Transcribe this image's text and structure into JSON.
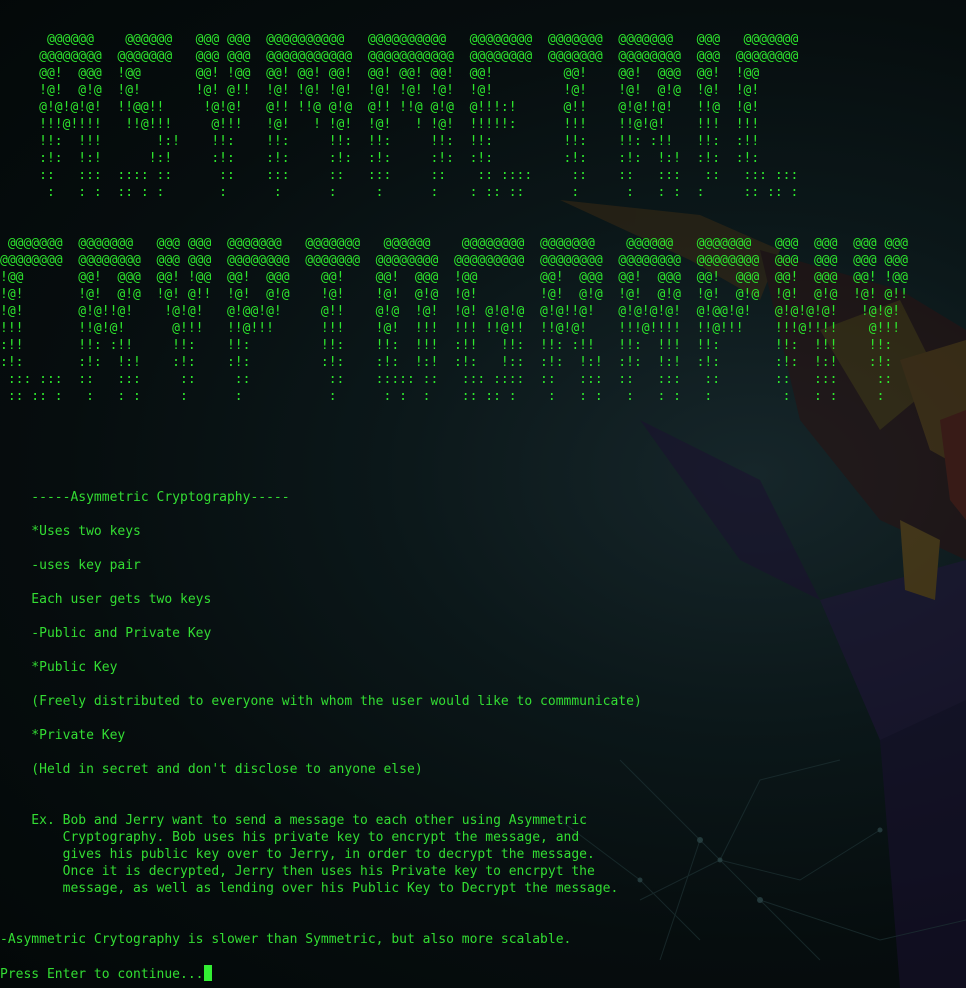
{
  "banner_top": [
    "      @@@@@@    @@@@@@   @@@ @@@  @@@@@@@@@@   @@@@@@@@@@   @@@@@@@@  @@@@@@@  @@@@@@@   @@@   @@@@@@@",
    "     @@@@@@@@  @@@@@@@   @@@ @@@  @@@@@@@@@@@  @@@@@@@@@@@  @@@@@@@@  @@@@@@@  @@@@@@@@  @@@  @@@@@@@@",
    "     @@!  @@@  !@@       @@! !@@  @@! @@! @@!  @@! @@! @@!  @@!         @@!    @@!  @@@  @@!  !@@",
    "     !@!  @!@  !@!       !@! @!!  !@! !@! !@!  !@! !@! !@!  !@!         !@!    !@!  @!@  !@!  !@!",
    "     @!@!@!@!  !!@@!!     !@!@!   @!! !!@ @!@  @!! !!@ @!@  @!!!:!      @!!    @!@!!@!   !!@  !@!",
    "     !!!@!!!!   !!@!!!     @!!!   !@!   ! !@!  !@!   ! !@!  !!!!!:      !!!    !!@!@!    !!!  !!!",
    "     !!:  !!!       !:!    !!:    !!:     !!:  !!:     !!:  !!:         !!:    !!: :!!   !!:  :!!",
    "     :!:  !:!      !:!     :!:    :!:     :!:  :!:     :!:  :!:         :!:    :!:  !:!  :!:  :!:",
    "     ::   :::  :::: ::      ::    :::     ::   :::     ::    :: ::::     ::    ::   :::   ::   ::: :::",
    "      :   : :  :: : :       :      :      :     :      :    : :: ::      :      :   : :  :     :: :: :"
  ],
  "banner_bottom": [
    " @@@@@@@  @@@@@@@   @@@ @@@  @@@@@@@   @@@@@@@   @@@@@@    @@@@@@@@  @@@@@@@    @@@@@@   @@@@@@@   @@@  @@@  @@@ @@@",
    "@@@@@@@@  @@@@@@@@  @@@ @@@  @@@@@@@@  @@@@@@@  @@@@@@@@  @@@@@@@@@  @@@@@@@@  @@@@@@@@  @@@@@@@@  @@@  @@@  @@@ @@@",
    "!@@       @@!  @@@  @@! !@@  @@!  @@@    @@!    @@!  @@@  !@@        @@!  @@@  @@!  @@@  @@!  @@@  @@!  @@@  @@! !@@",
    "!@!       !@!  @!@  !@! @!!  !@!  @!@    !@!    !@!  @!@  !@!        !@!  @!@  !@!  @!@  !@!  @!@  !@!  @!@  !@! @!!",
    "!@!       @!@!!@!    !@!@!   @!@@!@!     @!!    @!@  !@!  !@! @!@!@  @!@!!@!   @!@!@!@!  @!@@!@!   @!@!@!@!   !@!@!",
    "!!!       !!@!@!      @!!!   !!@!!!      !!!    !@!  !!!  !!! !!@!!  !!@!@!    !!!@!!!!  !!@!!!    !!!@!!!!    @!!!",
    ":!!       !!: :!!     !!:    !!:         !!:    !!:  !!!  :!!   !!:  !!: :!!   !!:  !!!  !!:       !!:  !!!    !!:",
    ":!:       :!:  !:!    :!:    :!:         :!:    :!:  !:!  :!:   !::  :!:  !:!  :!:  !:!  :!:       :!:  !:!    :!:",
    " ::: :::  ::   :::     ::     ::          ::    ::::: ::   ::: ::::  ::   :::  ::   :::   ::       ::   :::     ::",
    " :: :: :   :   : :     :      :           :      : :  :    :: :: :    :   : :   :   : :   :         :   : :     :"
  ],
  "lesson": {
    "heading": "    -----Asymmetric Cryptography-----",
    "uses_two_keys": "    *Uses two keys",
    "key_pair": "    -uses key pair",
    "each_user": "    Each user gets two keys",
    "public_private": "    -Public and Private Key",
    "public_key": "    *Public Key",
    "public_desc": "    (Freely distributed to everyone with whom the user would like to commmunicate)",
    "private_key": "    *Private Key",
    "private_desc": "    (Held in secret and don't disclose to anyone else)",
    "example": [
      "    Ex. Bob and Jerry want to send a message to each other using Asymmetric",
      "        Cryptography. Bob uses his private key to encrypt the message, and",
      "        gives his public key over to Jerry, in order to decrypt the message.",
      "        Once it is decrypted, Jerry then uses his Private key to encrpyt the",
      "        message, as well as lending over his Public Key to Decrypt the message."
    ],
    "summary": "-Asymmetric Crytography is slower than Symmetric, but also more scalable."
  },
  "prompt": {
    "text": "Press Enter to continue..."
  },
  "colors": {
    "text": "#33dd33",
    "cursor": "#33ee33",
    "background": "#040a0a"
  }
}
